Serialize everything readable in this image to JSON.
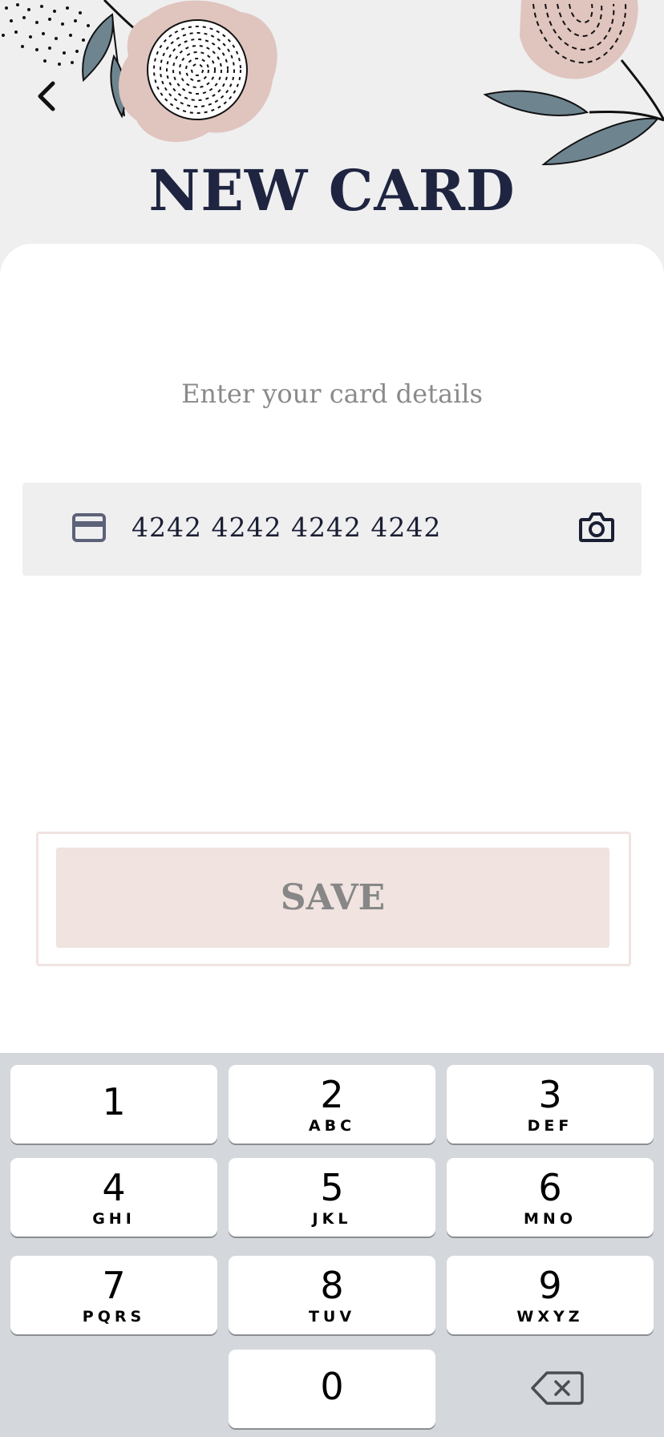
{
  "header": {
    "title": "NEW CARD"
  },
  "form": {
    "subtitle": "Enter your card details",
    "card_number_value": "4242 4242 4242 4242"
  },
  "actions": {
    "save_label": "SAVE"
  },
  "keypad": {
    "keys": [
      {
        "digit": "1",
        "letters": ""
      },
      {
        "digit": "2",
        "letters": "ABC"
      },
      {
        "digit": "3",
        "letters": "DEF"
      },
      {
        "digit": "4",
        "letters": "GHI"
      },
      {
        "digit": "5",
        "letters": "JKL"
      },
      {
        "digit": "6",
        "letters": "MNO"
      },
      {
        "digit": "7",
        "letters": "PQRS"
      },
      {
        "digit": "8",
        "letters": "TUV"
      },
      {
        "digit": "9",
        "letters": "WXYZ"
      },
      {
        "digit": "0",
        "letters": ""
      }
    ]
  },
  "icons": {
    "back": "chevron-left-icon",
    "card": "credit-card-icon",
    "camera": "camera-icon",
    "delete": "backspace-icon"
  },
  "colors": {
    "title": "#1f2540",
    "save_bg": "#f0e3e0",
    "save_text": "#878787",
    "field_bg": "#efeff0",
    "keypad_bg": "#d4d7db"
  }
}
